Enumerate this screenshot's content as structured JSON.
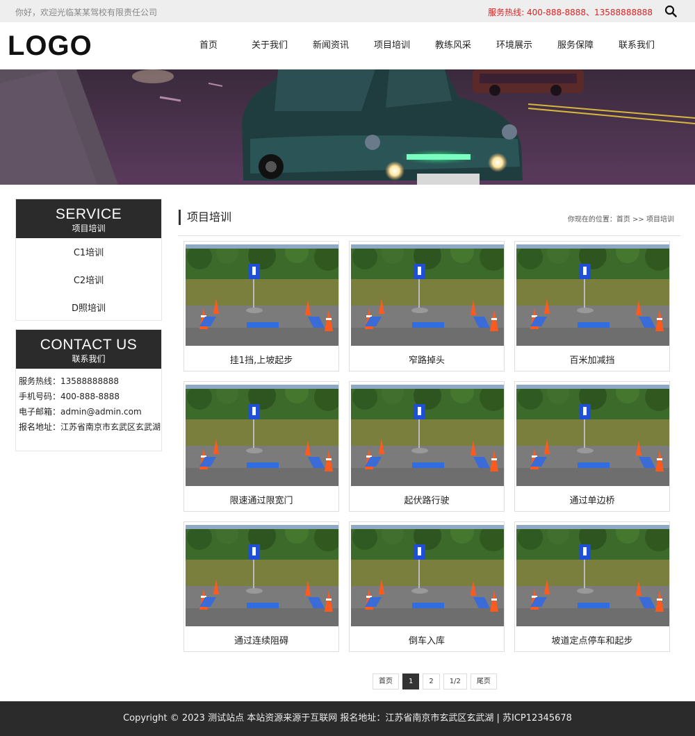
{
  "topbar": {
    "welcome": "你好，欢迎光临某某驾校有限责任公司",
    "hotline": "服务热线: 400-888-8888、13588888888"
  },
  "header": {
    "logo": "LOGO",
    "nav": [
      "首页",
      "关于我们",
      "新闻资讯",
      "项目培训",
      "教练风采",
      "环境展示",
      "服务保障",
      "联系我们"
    ]
  },
  "sidebar": {
    "service": {
      "title_en": "SERVICE",
      "title_cn": "项目培训",
      "items": [
        "C1培训",
        "C2培训",
        "D照培训"
      ]
    },
    "contact": {
      "title_en": "CONTACT US",
      "title_cn": "联系我们",
      "rows": [
        "服务热线：13588888888",
        "手机号码：400-888-8888",
        "电子邮箱：admin@admin.com",
        "报名地址：江苏省南京市玄武区玄武湖"
      ]
    }
  },
  "main": {
    "title": "项目培训",
    "breadcrumb": {
      "prefix": "你现在的位置：",
      "home": "首页",
      "sep": " >> ",
      "current": "项目培训"
    },
    "cards": [
      "挂1挡,上坡起步",
      "窄路掉头",
      "百米加减挡",
      "限速通过限宽门",
      "起伏路行驶",
      "通过单边桥",
      "通过连续阻碍",
      "倒车入库",
      "坡道定点停车和起步"
    ]
  },
  "pagination": {
    "first": "首页",
    "pages": [
      "1",
      "2"
    ],
    "current": "1",
    "status": "1/2",
    "last": "尾页"
  },
  "footer": {
    "text": "Copyright © 2023 测试站点 本站资源来源于互联网  报名地址：江苏省南京市玄武区玄武湖 | 苏ICP12345678"
  },
  "colors": {
    "accent_red": "#e02020",
    "dark": "#2b2b2b",
    "topbar_bg": "#eeeeee"
  }
}
